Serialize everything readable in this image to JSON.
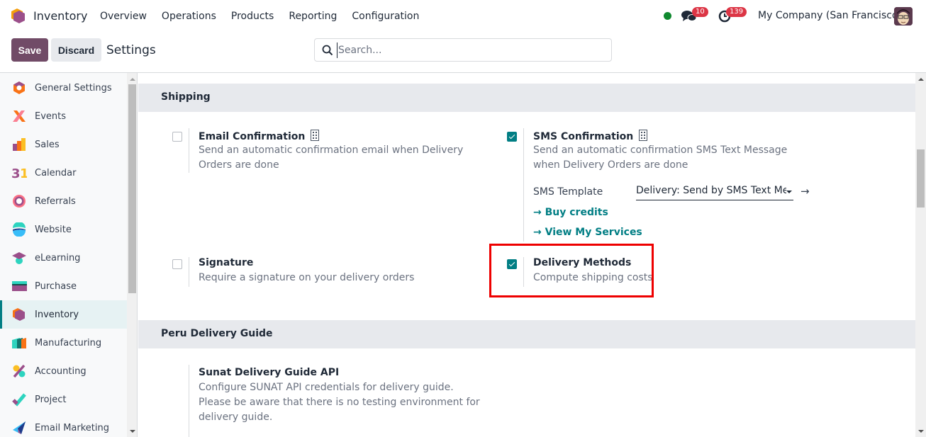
{
  "topnav": {
    "app_name": "Inventory",
    "menu": [
      "Overview",
      "Operations",
      "Products",
      "Reporting",
      "Configuration"
    ],
    "presence_status": "online",
    "presence_color": "#10892f",
    "messages_count": "10",
    "activities_count": "139",
    "company": "My Company (San Francisco)"
  },
  "control_panel": {
    "save_label": "Save",
    "discard_label": "Discard",
    "title": "Settings",
    "search_placeholder": "Search...",
    "search_value": ""
  },
  "sidebar": {
    "items": [
      {
        "label": "General Settings",
        "icon": "general-settings-icon"
      },
      {
        "label": "Events",
        "icon": "events-icon"
      },
      {
        "label": "Sales",
        "icon": "sales-icon"
      },
      {
        "label": "Calendar",
        "icon": "calendar-icon"
      },
      {
        "label": "Referrals",
        "icon": "referrals-icon"
      },
      {
        "label": "Website",
        "icon": "website-icon"
      },
      {
        "label": "eLearning",
        "icon": "elearning-icon"
      },
      {
        "label": "Purchase",
        "icon": "purchase-icon"
      },
      {
        "label": "Inventory",
        "icon": "inventory-icon",
        "active": true
      },
      {
        "label": "Manufacturing",
        "icon": "manufacturing-icon"
      },
      {
        "label": "Accounting",
        "icon": "accounting-icon"
      },
      {
        "label": "Project",
        "icon": "project-icon"
      },
      {
        "label": "Email Marketing",
        "icon": "email-marketing-icon"
      }
    ]
  },
  "sections": {
    "shipping": {
      "title": "Shipping",
      "email_confirmation": {
        "title": "Email Confirmation",
        "description": "Send an automatic confirmation email when Delivery Orders are done",
        "checked": false
      },
      "sms_confirmation": {
        "title": "SMS Confirmation",
        "description": "Send an automatic confirmation SMS Text Message when Delivery Orders are done",
        "checked": true,
        "template_label": "SMS Template",
        "template_value": "Delivery: Send by SMS Text Message",
        "buy_credits": "Buy credits",
        "view_services": "View My Services",
        "arrow": "→"
      },
      "signature": {
        "title": "Signature",
        "description": "Require a signature on your delivery orders",
        "checked": false
      },
      "delivery_methods": {
        "title": "Delivery Methods",
        "description": "Compute shipping costs",
        "checked": true
      }
    },
    "peru": {
      "title": "Peru Delivery Guide",
      "sunat": {
        "title": "Sunat Delivery Guide API",
        "description": "Configure SUNAT API credentials for delivery guide. Please be aware that there is no testing environment for delivery guide."
      }
    }
  },
  "colors": {
    "brand": "#714b67",
    "accent": "#017e84",
    "badge": "#dc3545",
    "highlight": "#ee0000"
  }
}
